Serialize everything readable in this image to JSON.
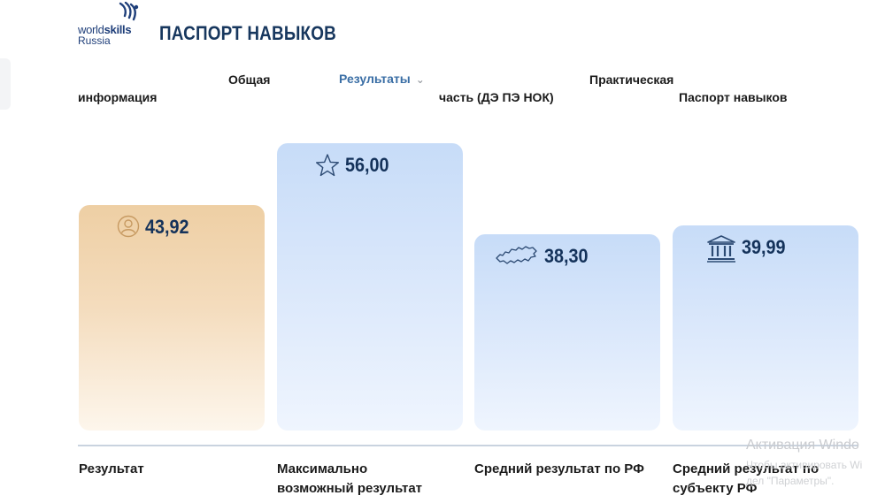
{
  "header": {
    "logo_world": "world",
    "logo_skills": "skills",
    "logo_region": "Russia",
    "title": "ПАСПОРТ НАВЫКОВ"
  },
  "tabs": [
    {
      "line1": "Общая",
      "line2": "информация"
    },
    {
      "label": "Результаты",
      "active": true
    },
    {
      "line1": "Практическая",
      "line2": "часть (ДЭ ПЭ НОК)"
    },
    {
      "label": "Паспорт навыков"
    }
  ],
  "chart_data": {
    "type": "bar",
    "categories": [
      "Результат",
      "Максимально возможный результат",
      "Средний результат по РФ",
      "Средний результат по субъекту РФ"
    ],
    "values": [
      43.92,
      56.0,
      38.3,
      39.99
    ],
    "value_labels": [
      "43,92",
      "56,00",
      "38,30",
      "39,99"
    ],
    "label_lines": [
      [
        "Результат"
      ],
      [
        "Максимально",
        "возможный результат"
      ],
      [
        "Средний результат по РФ"
      ],
      [
        "Средний результат по",
        "субъекту РФ"
      ]
    ],
    "icons": [
      "person-icon",
      "star-icon",
      "russia-map-icon",
      "institution-icon"
    ],
    "colors": [
      "#eecfa4",
      "#c7dcf8",
      "#c7dcf8",
      "#c7dcf8"
    ],
    "ylim": [
      0,
      56
    ]
  },
  "watermark": {
    "line1": "Активация Windo",
    "line2": "Чтобы активировать Wi",
    "line3": "дел \"Параметры\"."
  }
}
